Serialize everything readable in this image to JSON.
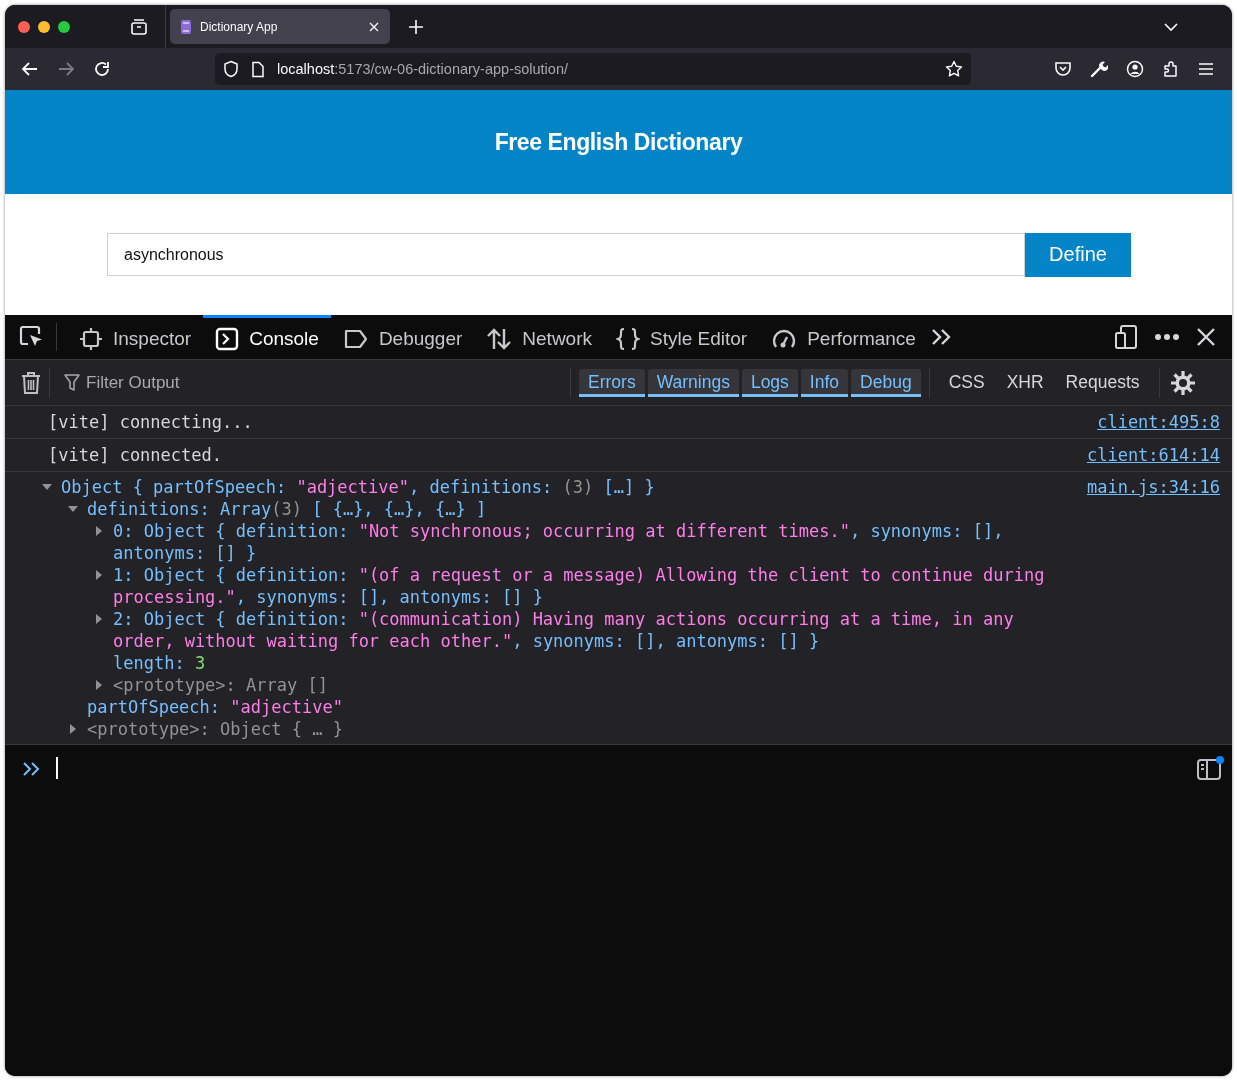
{
  "browser": {
    "tab_title": "Dictionary App",
    "url_host": "localhost",
    "url_rest": ":5173/cw-06-dictionary-app-solution/"
  },
  "page": {
    "title": "Free English Dictionary",
    "search": {
      "value": "asynchronous"
    },
    "button": "Define"
  },
  "devtools": {
    "tabs": [
      {
        "label": "Inspector",
        "kind": "inspector",
        "selected": false
      },
      {
        "label": "Console",
        "kind": "console",
        "selected": true
      },
      {
        "label": "Debugger",
        "kind": "debugger",
        "selected": false
      },
      {
        "label": "Network",
        "kind": "network",
        "selected": false
      },
      {
        "label": "Style Editor",
        "kind": "style",
        "selected": false
      },
      {
        "label": "Performance",
        "kind": "performance",
        "selected": false
      }
    ],
    "filter": {
      "placeholder": "Filter Output"
    },
    "levels": [
      {
        "label": "Errors",
        "selected": true
      },
      {
        "label": "Warnings",
        "selected": true
      },
      {
        "label": "Logs",
        "selected": true
      },
      {
        "label": "Info",
        "selected": true
      },
      {
        "label": "Debug",
        "selected": true
      }
    ],
    "extra_filters": [
      {
        "label": "CSS",
        "selected": false
      },
      {
        "label": "XHR",
        "selected": false
      },
      {
        "label": "Requests",
        "selected": false
      }
    ],
    "log": [
      {
        "kind": "text",
        "text": "[vite] connecting...",
        "source": "client:495:8"
      },
      {
        "kind": "text",
        "text": "[vite] connected.",
        "source": "client:614:14"
      },
      {
        "kind": "object",
        "source": "main.js:34:16",
        "tree": {
          "kind": "group",
          "expanded": true,
          "tokens": [
            {
              "kind": "key",
              "text": "Object { partOfSpeech: "
            },
            {
              "kind": "string",
              "text": "\"adjective\""
            },
            {
              "kind": "key",
              "text": ", definitions: "
            },
            {
              "kind": "muted",
              "text": "(3)"
            },
            {
              "kind": "key",
              "text": " […] }"
            }
          ],
          "children": [
            {
              "kind": "group",
              "expanded": true,
              "tokens": [
                {
                  "kind": "key",
                  "text": "definitions: Array"
                },
                {
                  "kind": "muted",
                  "text": "(3)"
                },
                {
                  "kind": "key",
                  "text": " [ {…}, {…}, {…} ]"
                }
              ],
              "children": [
                {
                  "kind": "group",
                  "expanded": false,
                  "tokens": [
                    {
                      "kind": "key",
                      "text": "0: Object { definition: "
                    },
                    {
                      "kind": "string",
                      "text": "\"Not synchronous; occurring at different times.\""
                    },
                    {
                      "kind": "key",
                      "text": ", synonyms: [], antonyms: [] }"
                    }
                  ]
                },
                {
                  "kind": "group",
                  "expanded": false,
                  "tokens": [
                    {
                      "kind": "key",
                      "text": "1: Object { definition: "
                    },
                    {
                      "kind": "string",
                      "text": "\"(of a request or a message) Allowing the client to continue during processing.\""
                    },
                    {
                      "kind": "key",
                      "text": ", synonyms: [], antonyms: [] }"
                    }
                  ]
                },
                {
                  "kind": "group",
                  "expanded": false,
                  "tokens": [
                    {
                      "kind": "key",
                      "text": "2: Object { definition: "
                    },
                    {
                      "kind": "string",
                      "text": "\"(communication) Having many actions occurring at a time, in any order, without waiting for each other.\""
                    },
                    {
                      "kind": "key",
                      "text": ", synonyms: [], antonyms: [] }"
                    }
                  ]
                },
                {
                  "kind": "leaf",
                  "tokens": [
                    {
                      "kind": "key",
                      "text": "length: "
                    },
                    {
                      "kind": "number",
                      "text": "3"
                    }
                  ]
                },
                {
                  "kind": "group",
                  "expanded": false,
                  "tokens": [
                    {
                      "kind": "muted",
                      "text": "<prototype>: Array []"
                    }
                  ]
                }
              ]
            },
            {
              "kind": "leaf",
              "tokens": [
                {
                  "kind": "key",
                  "text": "partOfSpeech: "
                },
                {
                  "kind": "string",
                  "text": "\"adjective\""
                }
              ]
            },
            {
              "kind": "group",
              "expanded": false,
              "tokens": [
                {
                  "kind": "muted",
                  "text": "<prototype>: Object { … }"
                }
              ]
            }
          ]
        }
      }
    ]
  }
}
